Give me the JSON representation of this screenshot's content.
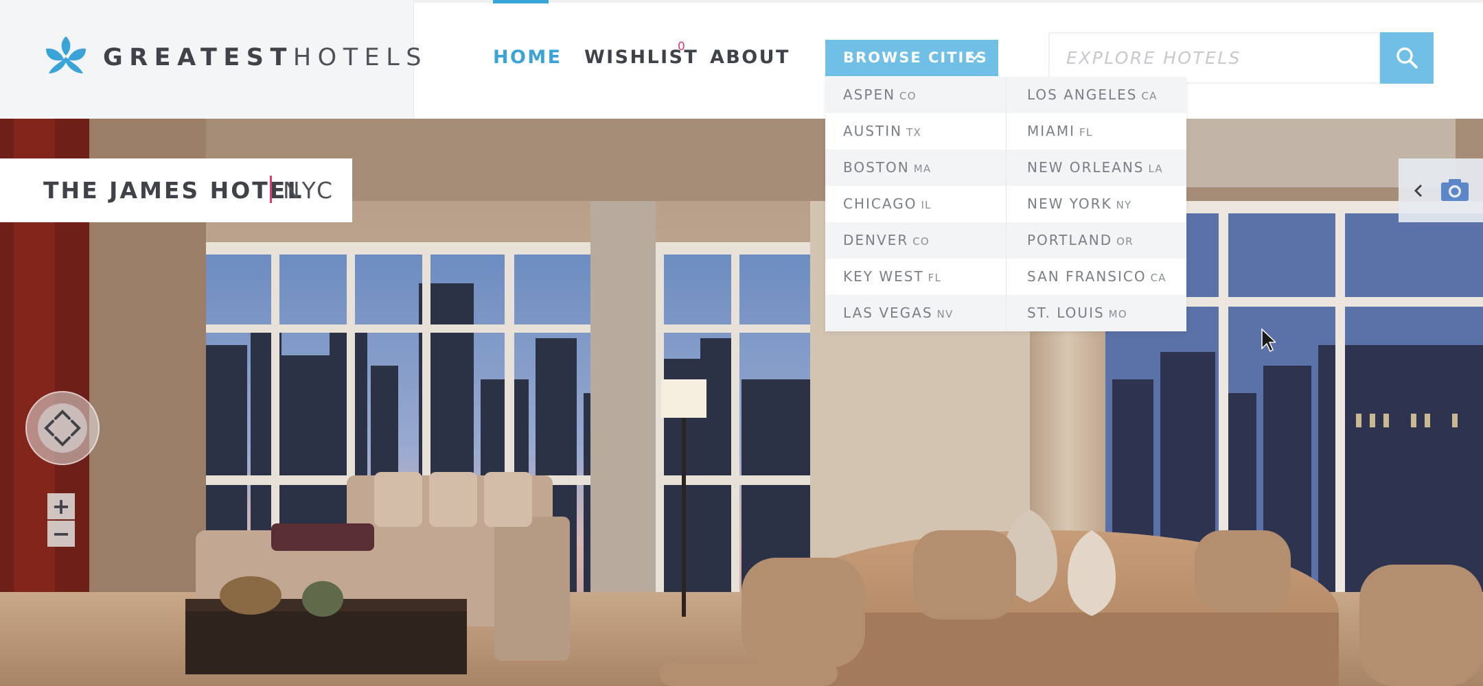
{
  "logo": {
    "text_bold": "GREATEST",
    "text_light": "HOTELS",
    "icon": "fleur-logo-icon",
    "brand_color": "#3aa3d8"
  },
  "nav": {
    "home": "HOME",
    "wishlist": "WISHLIST",
    "wishlist_count": "0",
    "about": "ABOUT",
    "active_item": "HOME",
    "browse_label": "BROWSE CITIES"
  },
  "search": {
    "placeholder": "EXPLORE HOTELS",
    "icon": "search-icon"
  },
  "cities": {
    "left": [
      {
        "name": "ASPEN",
        "state": "CO"
      },
      {
        "name": "AUSTIN",
        "state": "TX"
      },
      {
        "name": "BOSTON",
        "state": "MA"
      },
      {
        "name": "CHICAGO",
        "state": "IL"
      },
      {
        "name": "DENVER",
        "state": "CO"
      },
      {
        "name": "KEY WEST",
        "state": "FL"
      },
      {
        "name": "LAS VEGAS",
        "state": "NV"
      }
    ],
    "right": [
      {
        "name": "LOS ANGELES",
        "state": "CA"
      },
      {
        "name": "MIAMI",
        "state": "FL"
      },
      {
        "name": "NEW ORLEANS",
        "state": "LA"
      },
      {
        "name": "NEW YORK",
        "state": "NY"
      },
      {
        "name": "PORTLAND",
        "state": "OR"
      },
      {
        "name": "SAN FRANSICO",
        "state": "CA"
      },
      {
        "name": "ST. LOUIS",
        "state": "MO"
      }
    ]
  },
  "hotel": {
    "name": "THE JAMES HOTEL",
    "city": "NYC"
  },
  "controls": {
    "zoom_in": "+",
    "zoom_out": "−"
  },
  "colors": {
    "accent": "#3aa3d8",
    "button": "#6fbfe6",
    "highlight": "#e03a6e",
    "text": "#3f4349"
  }
}
